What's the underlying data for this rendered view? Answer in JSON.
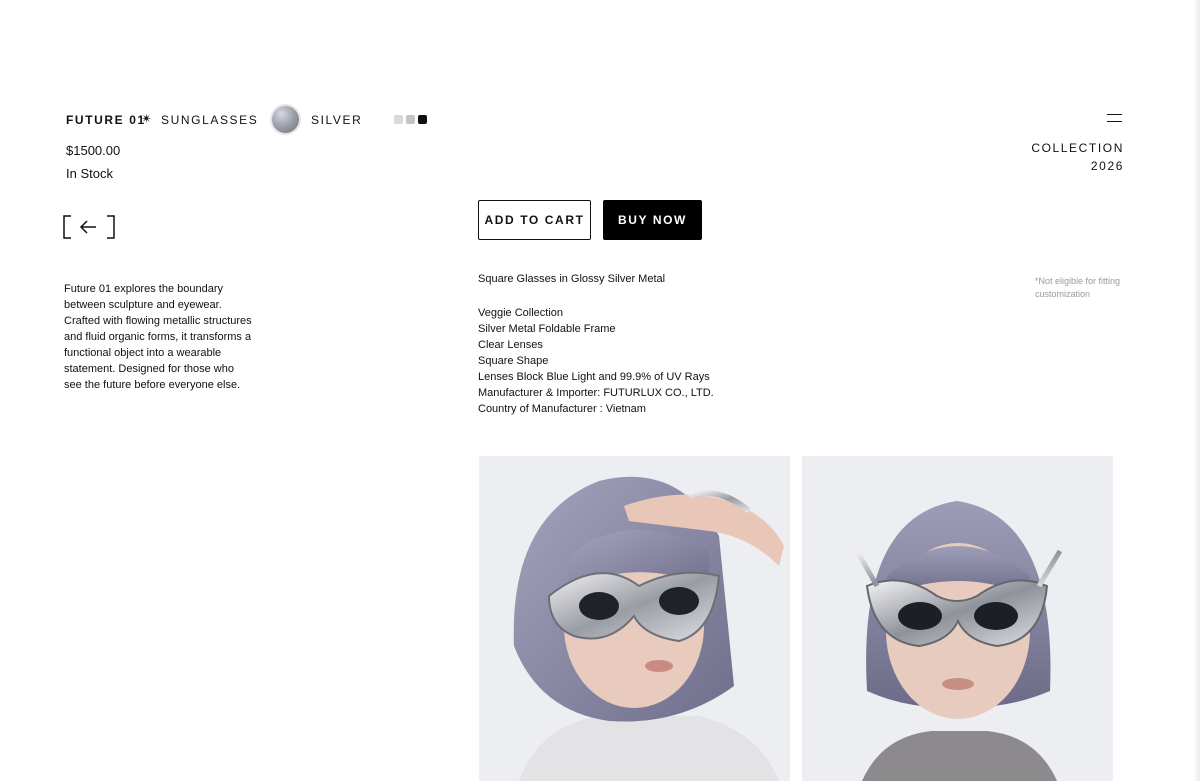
{
  "product": {
    "name": "FUTURE 01",
    "separator_icon": "sparkle-icon",
    "type": "SUNGLASSES",
    "color_name": "SILVER",
    "price": "$1500.00",
    "stock": "In Stock",
    "variant_colors": [
      "#d9d9d9",
      "#c4c4c4",
      "#111111"
    ]
  },
  "header": {
    "collection_label": "COLLECTION",
    "collection_year": "2026",
    "menu_icon": "menu-icon"
  },
  "nav": {
    "back_icon": "back-arrow-icon"
  },
  "description": "Future 01 explores the boundary between sculpture and eyewear. Crafted with flowing metallic structures and fluid organic forms, it transforms a functional object into a wearable statement. Designed for those who see the future before everyone else.",
  "actions": {
    "add_to_cart": "ADD TO CART",
    "buy_now": "BUY NOW"
  },
  "specs": {
    "title": "Square Glasses in Glossy Silver Metal",
    "items": [
      "Veggie Collection",
      "Silver Metal Foldable Frame",
      "Clear Lenses",
      "Square Shape",
      "Lenses Block Blue Light and 99.9% of UV Rays",
      "Manufacturer & Importer: FUTURLUX CO., LTD.",
      "Country of Manufacturer : Vietnam"
    ],
    "note": "*Not eligible for fitting customization"
  },
  "images": [
    {
      "name": "model-photo-side"
    },
    {
      "name": "model-photo-front"
    }
  ],
  "colors": {
    "accent": "#000000",
    "background": "#ffffff",
    "photo_bg": "#eceef2",
    "hair": "#8a8aa6"
  }
}
